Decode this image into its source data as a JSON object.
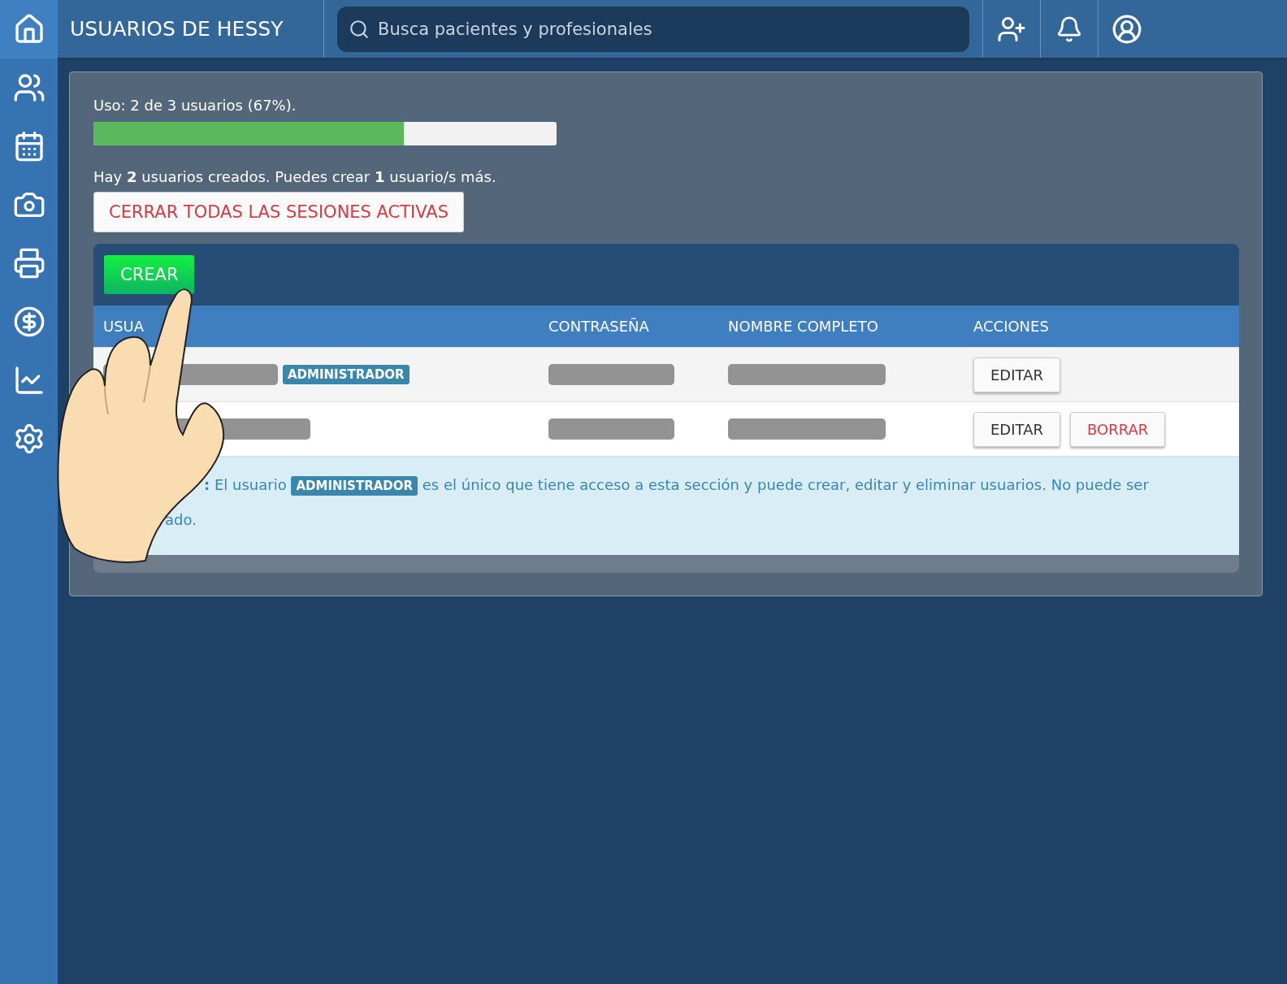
{
  "topbar": {
    "title": "USUARIOS DE HESSY",
    "search": {
      "placeholder": "Busca pacientes y profesionales"
    }
  },
  "sidebar": {
    "items": [
      {
        "kind": "home",
        "selected": true
      },
      {
        "kind": "users",
        "selected": false
      },
      {
        "kind": "calendar",
        "selected": false
      },
      {
        "kind": "camera",
        "selected": false
      },
      {
        "kind": "printer",
        "selected": false
      },
      {
        "kind": "money",
        "selected": false
      },
      {
        "kind": "chart",
        "selected": false
      },
      {
        "kind": "settings",
        "selected": false
      }
    ]
  },
  "usage": {
    "text": "Uso: 2 de 3 usuarios (67%).",
    "level": 0.67
  },
  "summary": "Hay **2** usuarios creados. Puedes crear **1** usuario/s más.",
  "close_sessions_button": "CERRAR TODAS LAS SESIONES ACTIVAS",
  "create_button": "CREAR",
  "table": {
    "columns": [
      "USUA",
      "CONTRASEÑA",
      "NOMBRE COMPLETO",
      "ACCIONES"
    ],
    "rows": [
      {
        "badge": "ADMINISTRADOR",
        "actions": [
          {
            "kind": "edit",
            "label": "EDITAR"
          }
        ]
      },
      {
        "actions": [
          {
            "kind": "edit",
            "label": "EDITAR"
          },
          {
            "kind": "delete",
            "label": "BORRAR"
          }
        ]
      }
    ]
  },
  "note": {
    "lead": ":",
    "before": "El usuario",
    "badge": "ADMINISTRADOR",
    "after": "es el único que tiene acceso a esta sección y puede crear, editar y eliminar usuarios. No puede ser",
    "line2": "ado."
  }
}
